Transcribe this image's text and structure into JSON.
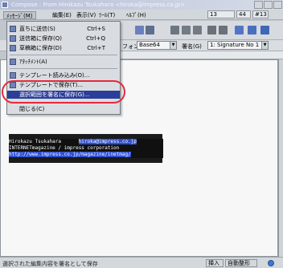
{
  "window": {
    "title": "Compose : From Hirokazu Tsukahara <hiroka@impress.co.jp>"
  },
  "menubar": {
    "items": [
      {
        "label": "ﾒｯｾｰｼﾞ(M)",
        "active": true
      },
      {
        "label": "編集(E)",
        "active": false
      },
      {
        "label": "表示(V)",
        "active": false
      },
      {
        "label": "ﾂｰﾙ(T)",
        "active": false
      },
      {
        "label": "ﾍﾙﾌﾟ(H)",
        "active": false
      }
    ],
    "line_col": {
      "label1": "13",
      "label2": "44",
      "label3": "#13"
    }
  },
  "dropdown": {
    "items": [
      {
        "label": "直ちに送信(S)",
        "shortcut": "Ctrl+S"
      },
      {
        "label": "送信箱に保存(Q)",
        "shortcut": "Ctrl+Q"
      },
      {
        "label": "草稿箱に保存(D)",
        "shortcut": "Ctrl+T"
      },
      {
        "label": "ｱﾀｯﾁﾒﾝﾄ(A)",
        "shortcut": ""
      },
      {
        "label": "テンプレート読み込み(O)...",
        "shortcut": ""
      },
      {
        "label": "テンプレートで保存(T)...",
        "shortcut": ""
      },
      {
        "label": "選択範囲を署名に保存(G)...",
        "shortcut": ""
      },
      {
        "label": "閉じる(C)",
        "shortcut": ""
      }
    ]
  },
  "toolbar2": {
    "font_label": "フォント",
    "font_value": "Base64",
    "signature_label": "署名(G)",
    "signature_value": "1: Signature No 1"
  },
  "editor": {
    "signature": {
      "line1_text": "Hirokazu Tsukahara",
      "line1_email": "hiroka@impress.co.jp",
      "line2_text": "INTERNETmagazine / impress corporation",
      "line3_url": "http://www.impress.co.jp/magazine/inetmag/"
    }
  },
  "statusbar": {
    "message": "選択された編集内容を署名として保存",
    "pane1": "挿入",
    "pane2": "自動整形"
  },
  "colors": {
    "highlight_oval": "#e7283c",
    "menu_highlight": "#2b3e9a",
    "signature_selection": "#2f4fcf"
  }
}
